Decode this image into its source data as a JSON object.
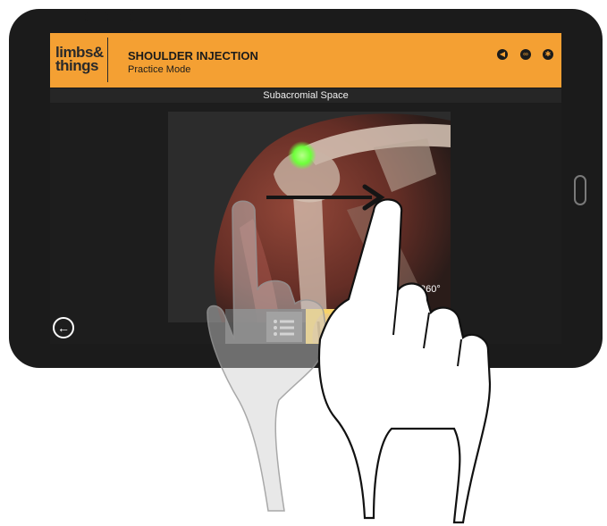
{
  "app": {
    "brand_line1": "limbs&",
    "brand_line2": "things",
    "title": "SHOULDER INJECTION",
    "subtitle": "Practice Mode"
  },
  "viewer": {
    "label": "Subacromial Space",
    "rotate_label": "360°"
  },
  "icons": [
    "speaker-icon",
    "link-icon",
    "gear-icon",
    "back-arrow-icon",
    "list-icon"
  ],
  "colors": {
    "header": "#f4a033",
    "tablet_bezel": "#1b1b1b",
    "injection_site": "#6dff3a",
    "selected_thumbnail": "#f7d36a"
  }
}
